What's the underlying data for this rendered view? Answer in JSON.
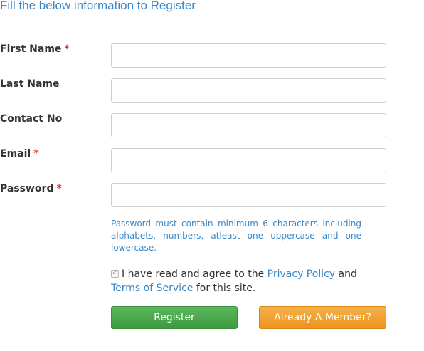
{
  "header": {
    "title": "Fill the below information to Register"
  },
  "form": {
    "fields": [
      {
        "label": "First Name",
        "required_mark": "*",
        "value": ""
      },
      {
        "label": "Last Name",
        "value": ""
      },
      {
        "label": "Contact No",
        "value": ""
      },
      {
        "label": "Email",
        "required_mark": "*",
        "value": ""
      },
      {
        "label": "Password",
        "required_mark": "*",
        "value": ""
      }
    ],
    "password_hint": "Password must contain minimum 6 characters including alphabets, numbers, atleast one uppercase and one lowercase.",
    "agree": {
      "checked": true,
      "text_before": "I have read and agree to the",
      "privacy_link": "Privacy Policy",
      "text_and": "and",
      "terms_link": "Terms of Service",
      "text_after": "for this site."
    },
    "buttons": {
      "register": "Register",
      "member": "Already A Member?"
    }
  },
  "colors": {
    "accent_blue": "#3a87c8",
    "required_red": "#d9342b",
    "register_green": "#4cae4c",
    "member_orange": "#f0a030"
  },
  "icons": {
    "checkbox_mark": "check-icon"
  }
}
